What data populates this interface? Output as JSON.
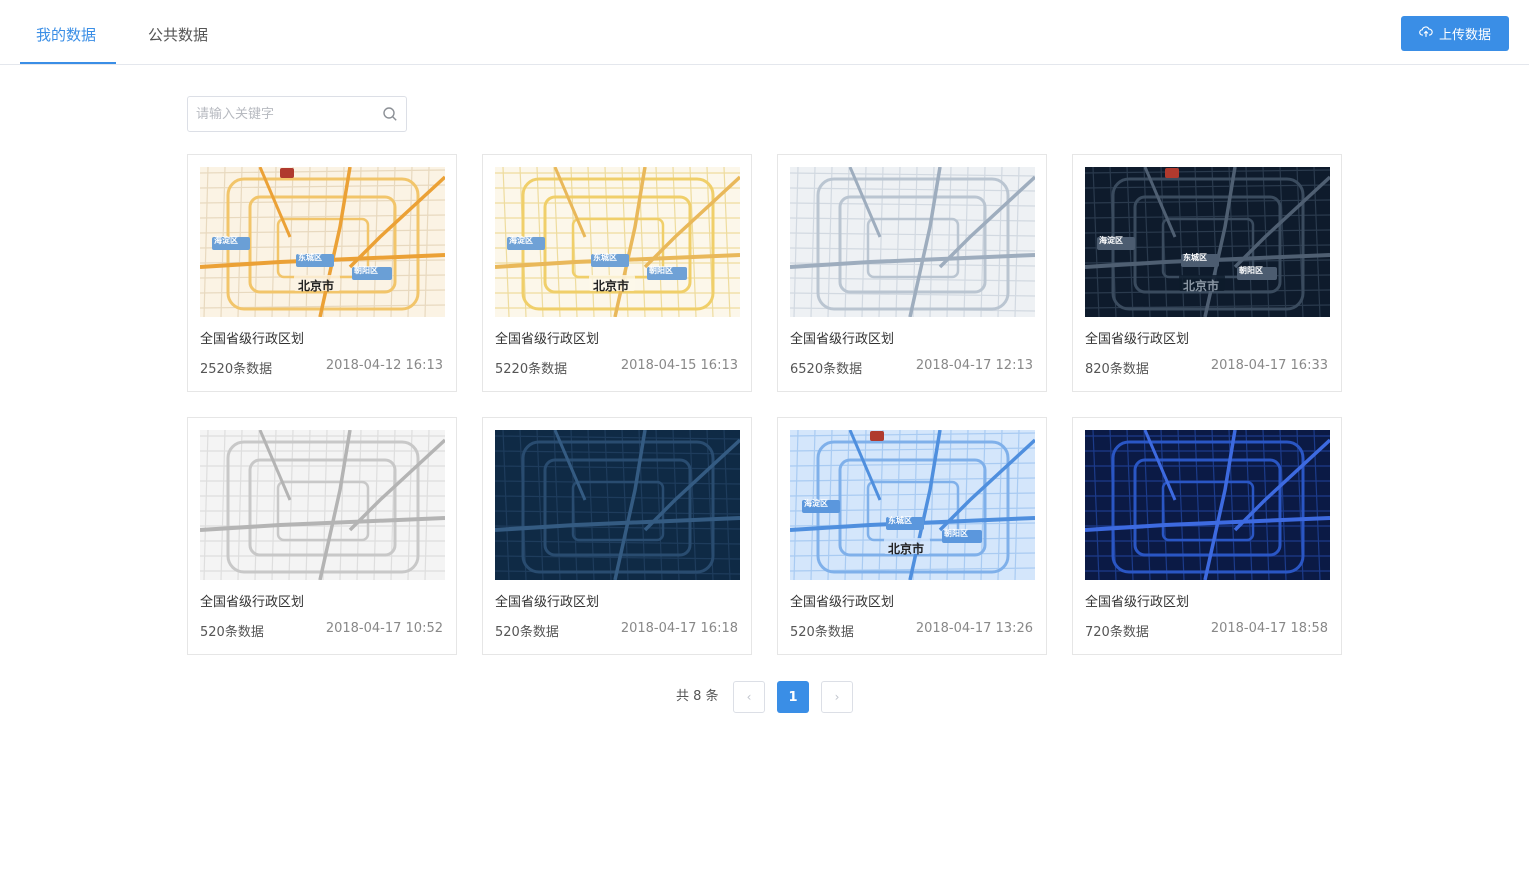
{
  "tabs": [
    {
      "label": "我的数据",
      "active": true
    },
    {
      "label": "公共数据",
      "active": false
    }
  ],
  "upload_button": {
    "label": "上传数据",
    "icon": "cloud-upload-icon"
  },
  "search": {
    "placeholder": "请输入关键字",
    "value": "",
    "icon": "search-icon"
  },
  "colors": {
    "accent": "#3a8ee6",
    "border": "#e6e6e6"
  },
  "cards": [
    {
      "title": "全国省级行政区划",
      "count": "2520条数据",
      "date": "2018-04-12 16:13",
      "style": "warm",
      "labels": [
        "海淀区",
        "东城区",
        "朝阳区",
        "北京市"
      ]
    },
    {
      "title": "全国省级行政区划",
      "count": "5220条数据",
      "date": "2018-04-15 16:13",
      "style": "yellow",
      "labels": [
        "海淀区",
        "东城区",
        "朝阳区",
        "北京市"
      ]
    },
    {
      "title": "全国省级行政区划",
      "count": "6520条数据",
      "date": "2018-04-17 12:13",
      "style": "gray",
      "labels": []
    },
    {
      "title": "全国省级行政区划",
      "count": "820条数据",
      "date": "2018-04-17 16:33",
      "style": "dark",
      "labels": [
        "海淀区",
        "东城区",
        "朝阳区",
        "北京市"
      ]
    },
    {
      "title": "全国省级行政区划",
      "count": "520条数据",
      "date": "2018-04-17 10:52",
      "style": "light",
      "labels": []
    },
    {
      "title": "全国省级行政区划",
      "count": "520条数据",
      "date": "2018-04-17 16:18",
      "style": "navy",
      "labels": []
    },
    {
      "title": "全国省级行政区划",
      "count": "520条数据",
      "date": "2018-04-17 13:26",
      "style": "blue",
      "labels": [
        "海淀区",
        "东城区",
        "朝阳区",
        "北京市"
      ]
    },
    {
      "title": "全国省级行政区划",
      "count": "720条数据",
      "date": "2018-04-17 18:58",
      "style": "midnight",
      "labels": []
    }
  ],
  "pagination": {
    "total_text": "共 8 条",
    "current_page": "1",
    "prev_icon": "chevron-left-icon",
    "next_icon": "chevron-right-icon"
  }
}
